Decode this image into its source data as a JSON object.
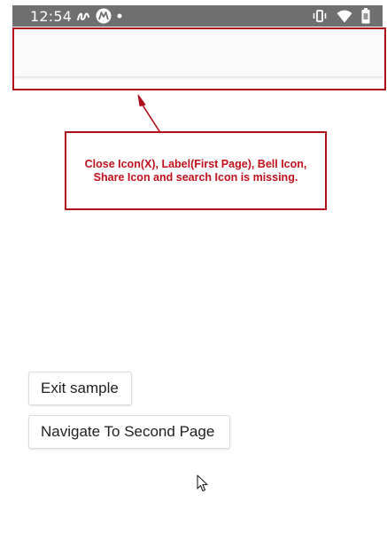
{
  "status_bar": {
    "time": "12:54",
    "background": "#6f6f6f",
    "left_icons": [
      "swirl-icon",
      "motorola-icon",
      "dot-icon"
    ],
    "right_icons": [
      "vibrate-icon",
      "wifi-icon",
      "battery-icon"
    ]
  },
  "app_bar": {
    "background": "#fafafa"
  },
  "annotation": {
    "color": "#b00d1a",
    "message": "Close Icon(X), Label(First Page), Bell Icon,\nShare Icon and search Icon is missing."
  },
  "buttons": {
    "exit_label": "Exit sample",
    "navigate_label": "Navigate To Second Page"
  }
}
